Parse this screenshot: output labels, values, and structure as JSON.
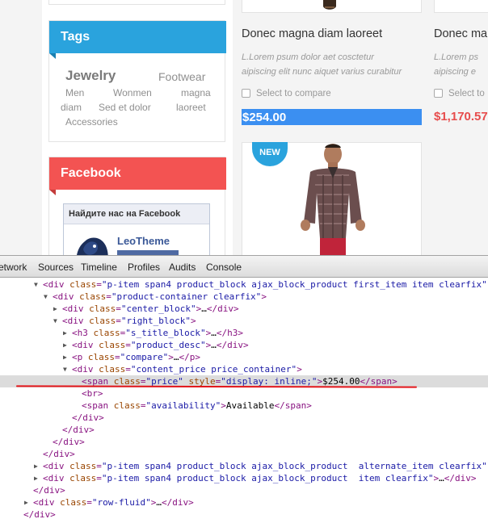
{
  "site": {
    "tags_block": {
      "title": "Tags",
      "tags": [
        "Jewelry",
        "Footwear",
        "Men",
        "Wonmen",
        "magna",
        "diam",
        "Sed et dolor",
        "laoreet",
        "Accessories"
      ]
    },
    "facebook_block": {
      "title": "Facebook",
      "widget_header": "Найдите нас на Facebook",
      "page_name": "LeoTheme"
    },
    "products": [
      {
        "title": "Donec magna diam laoreet",
        "desc_line1": "L.Lorem psum dolor aet cosctetur",
        "desc_line2": "aipiscing elit nunc  aiquet varius curabitur",
        "compare": "Select to compare",
        "price": "$254.00"
      },
      {
        "title": "Donec ma",
        "desc_line1": "L.Lorem ps",
        "desc_line2": "aipiscing e",
        "compare": "Select to",
        "price": "$1,170.57"
      }
    ],
    "new_badge": "NEW"
  },
  "devtools": {
    "tabs": [
      "etwork",
      "Sources",
      "Timeline",
      "Profiles",
      "Audits",
      "Console"
    ]
  },
  "colors": {
    "tags_header": "#2aa3dd",
    "facebook_header": "#f35352",
    "price_red": "#e74c4c",
    "price_highlight": "#3b8ff1",
    "devtools_tag": "#881280",
    "devtools_attr": "#994500",
    "devtools_value": "#1a1aa6",
    "annotation_red": "#e3161b"
  }
}
